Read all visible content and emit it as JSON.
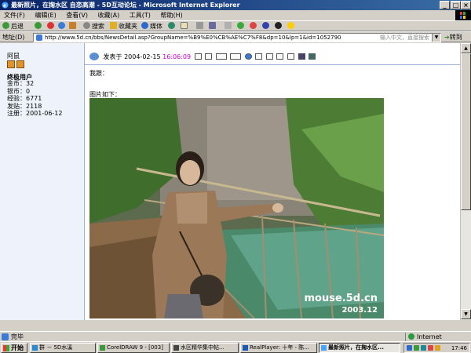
{
  "window": {
    "title": "最新照片，在掬水区 自恋高潮 - 5D互动论坛 - Microsoft Internet Explorer",
    "controls": [
      "_",
      "□",
      "×"
    ]
  },
  "menu": [
    "文件(F)",
    "编辑(E)",
    "查看(V)",
    "收藏(A)",
    "工具(T)",
    "帮助(H)"
  ],
  "toolbar": {
    "back": "后退",
    "search": "搜索",
    "favorites": "收藏夹",
    "media": "媒体"
  },
  "address": {
    "label": "地址(D)",
    "url": "http://www.5d.cn/bbs/NewsDetail.asp?GroupName=%B9%E0%CB%AE%C7%F8&dp=10&lp=1&id=1052790",
    "hint": "输入中文，直接搜索",
    "go": "转到"
  },
  "author": {
    "name": "阿鼠",
    "rank": "终极用户",
    "stats": [
      "金币：32",
      "银币：0",
      "经验：6771",
      "发贴：2118",
      "注册：2001-06-12"
    ]
  },
  "post": {
    "posted_prefix": "发表于",
    "date": "2004-02-15",
    "time": "16:06:09",
    "line1": "我跟：",
    "line2": "图片如下："
  },
  "photo": {
    "watermark_site": "mouse.5d.cn",
    "watermark_date": "2003.12"
  },
  "status": {
    "text": "完毕",
    "zone": "Internet"
  },
  "taskbar": {
    "start": "开始",
    "tasks": [
      "群 － 5D水溪",
      "CorelDRAW 9 - [003]",
      "水区精华集中帖...",
      "RealPlayer: 十年 - 陈...",
      "最新照片，在掬水区..."
    ],
    "clock": "17:46"
  }
}
